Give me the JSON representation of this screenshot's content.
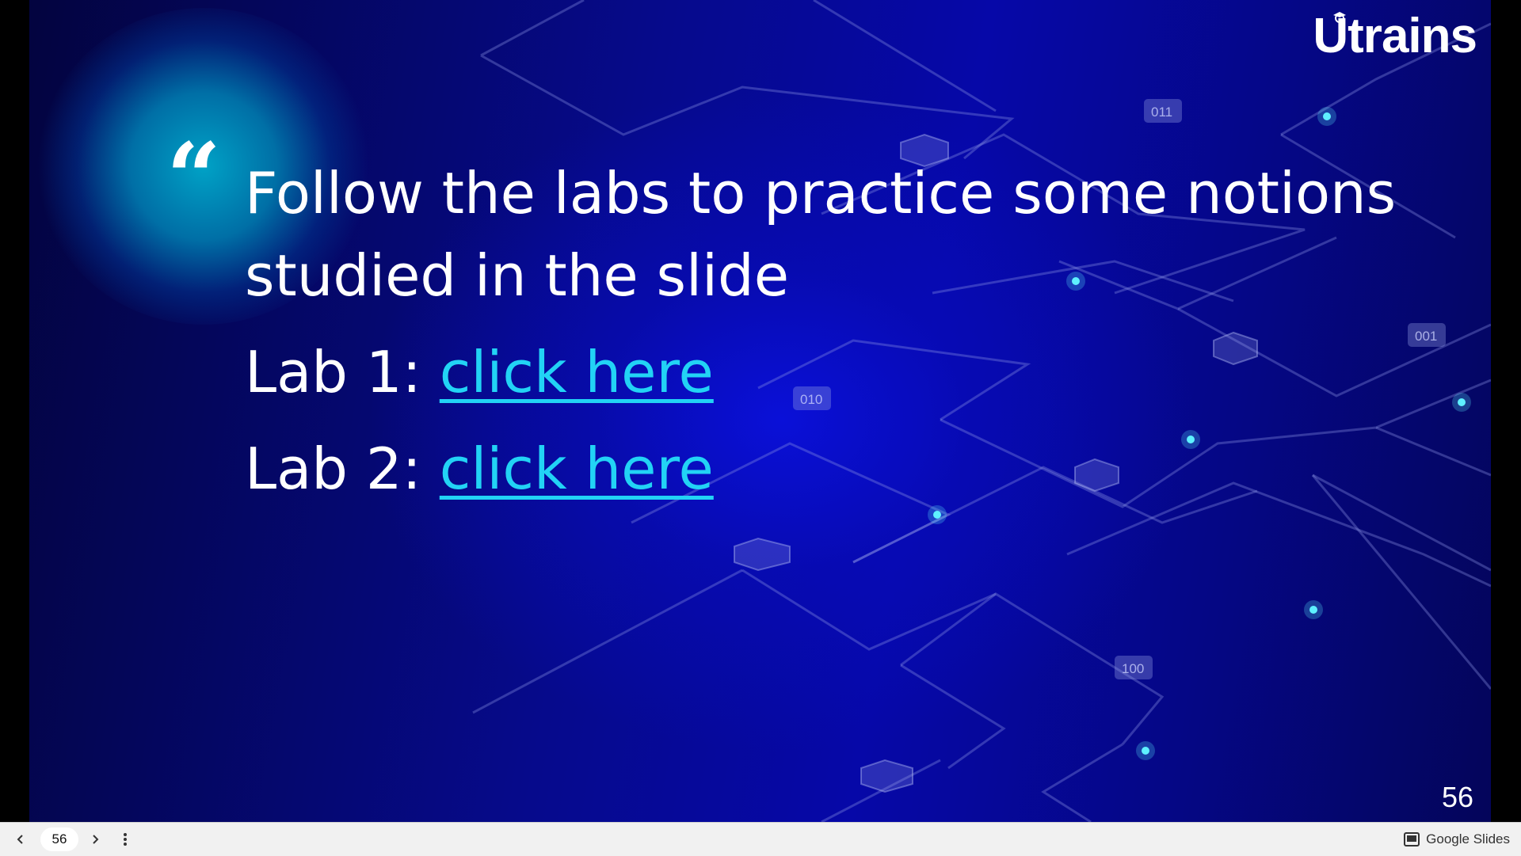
{
  "slide": {
    "logo_text": "Utrains",
    "quote_mark": "“",
    "intro_text": "Follow the labs to practice some notions studied in the slide",
    "labs": [
      {
        "label": "Lab 1: ",
        "link_text": "click here"
      },
      {
        "label": "Lab 2: ",
        "link_text": "click here"
      }
    ],
    "slide_number": "56",
    "binary_tags": [
      "011",
      "001",
      "010",
      "100"
    ]
  },
  "toolbar": {
    "prev_icon": "chevron-left-icon",
    "current_page": "56",
    "next_icon": "chevron-right-icon",
    "more_icon": "more-vert-icon",
    "brand_label": "Google Slides",
    "brand_icon": "slides-icon"
  },
  "colors": {
    "link": "#22d3f5",
    "background": "#0608a8",
    "glow": "#00a2c6",
    "toolbar": "#f1f1f1"
  }
}
